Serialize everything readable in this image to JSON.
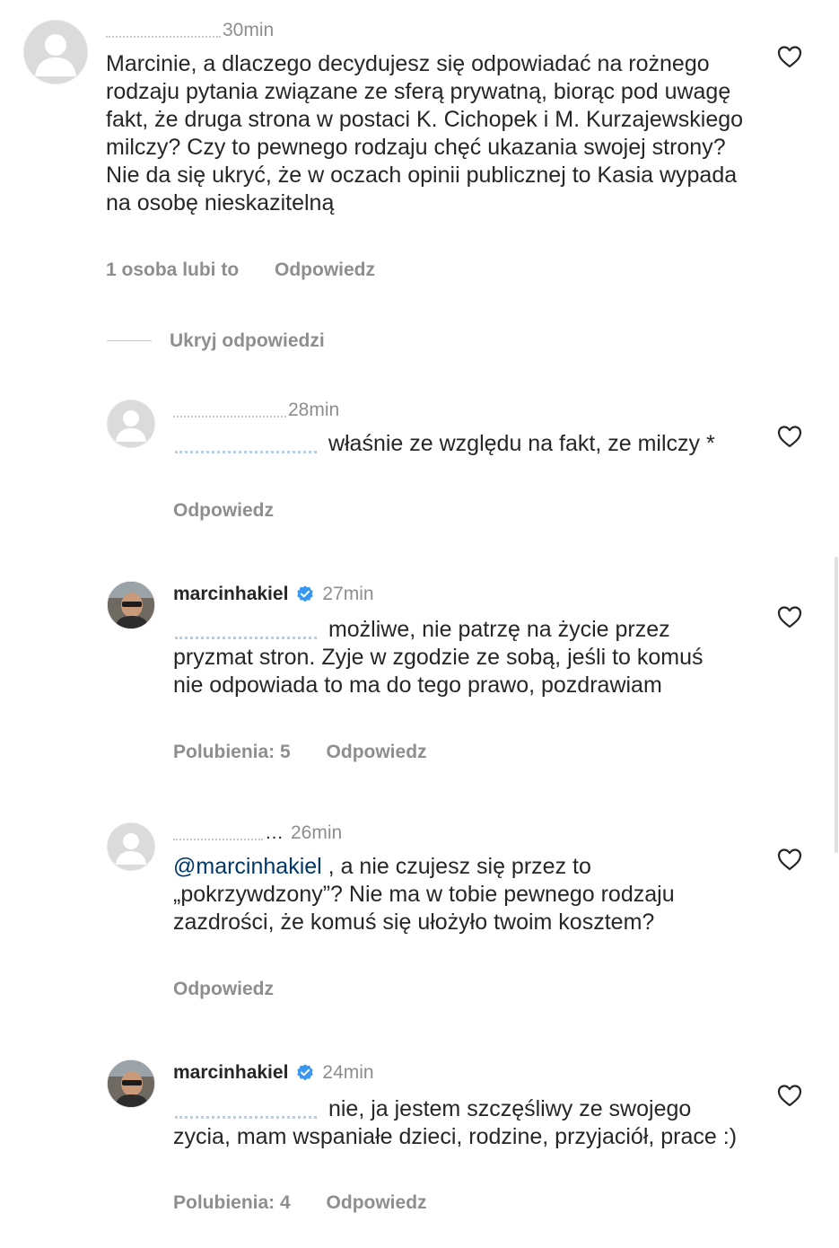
{
  "comments": [
    {
      "time": "30min",
      "text": "Marcinie, a dlaczego decydujesz się odpowiadać na rożnego rodzaju pytania związane ze sferą prywatną, biorąc pod uwagę fakt, że druga strona w postaci K. Cichopek i M. Kurzajewskiego milczy? Czy to pewnego rodzaju chęć ukazania swojej strony? Nie da się ukryć, że w oczach opinii publicznej to Kasia wypada na osobę nieskazitelną",
      "likes": "1 osoba lubi to",
      "reply": "Odpowiedz"
    }
  ],
  "hide_replies": "Ukryj odpowiedzi",
  "replies": [
    {
      "time": "28min",
      "text": "właśnie ze względu na fakt, ze milczy *",
      "reply": "Odpowiedz"
    },
    {
      "username": "marcinhakiel",
      "time": "27min",
      "text": "możliwe, nie patrzę na życie przez pryzmat stron. Zyje w zgodzie ze sobą, jeśli to komuś nie odpowiada to ma do tego prawo, pozdrawiam",
      "likes": "Polubienia: 5",
      "reply": "Odpowiedz"
    },
    {
      "username_partial": "…",
      "time": "26min",
      "mention": "@marcinhakiel",
      "text": ", a nie czujesz się przez to „pokrzywdzony”? Nie ma w tobie pewnego rodzaju zazdrości, że komuś się ułożyło twoim kosztem?",
      "reply": "Odpowiedz"
    },
    {
      "username": "marcinhakiel",
      "time": "24min",
      "text": "nie, ja jestem szczęśliwy ze swojego zycia, mam wspaniałe dzieci, rodzine, przyjaciół, prace :)",
      "likes": "Polubienia: 4",
      "reply": "Odpowiedz"
    }
  ],
  "icons": {
    "heart": "heart-outline-icon",
    "verified": "verified-badge-icon",
    "avatar_default": "default-avatar-icon"
  },
  "colors": {
    "text": "#262626",
    "secondary": "#8e8e8e",
    "mention": "#00376b",
    "verified": "#3897f0"
  }
}
